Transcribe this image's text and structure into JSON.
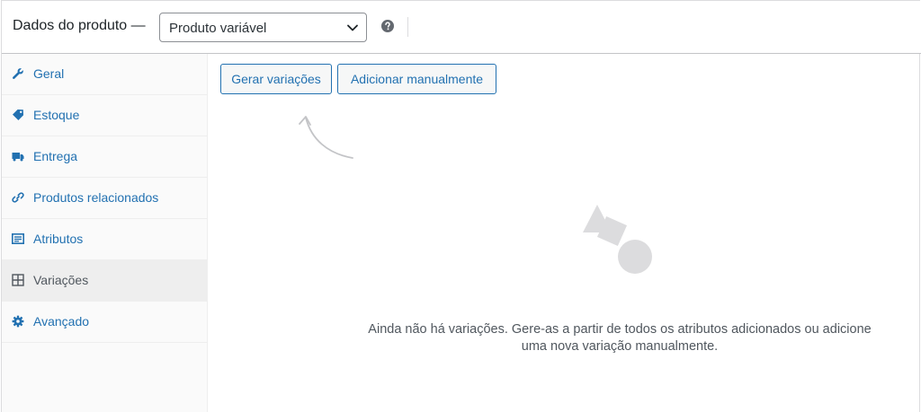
{
  "header": {
    "title": "Dados do produto —",
    "product_type": "Produto variável"
  },
  "sidebar": {
    "items": [
      {
        "label": "Geral",
        "icon": "wrench-icon"
      },
      {
        "label": "Estoque",
        "icon": "tag-icon"
      },
      {
        "label": "Entrega",
        "icon": "truck-icon"
      },
      {
        "label": "Produtos relacionados",
        "icon": "link-icon"
      },
      {
        "label": "Atributos",
        "icon": "list-icon"
      },
      {
        "label": "Variações",
        "icon": "grid-icon",
        "active": true
      },
      {
        "label": "Avançado",
        "icon": "gear-icon"
      }
    ]
  },
  "main": {
    "generate_button": "Gerar variações",
    "manual_button": "Adicionar manualmente",
    "empty_line_1": "Ainda não há variações. Gere-as a partir de todos os atributos adicionados ou adicione",
    "empty_line_2": "uma nova variação manualmente."
  },
  "colors": {
    "link": "#2271b1",
    "muted_text": "#50575e",
    "sidebar_bg": "#fafafa",
    "active_tab_bg": "#eeeeee",
    "placeholder_shapes": "#dcdcde"
  }
}
